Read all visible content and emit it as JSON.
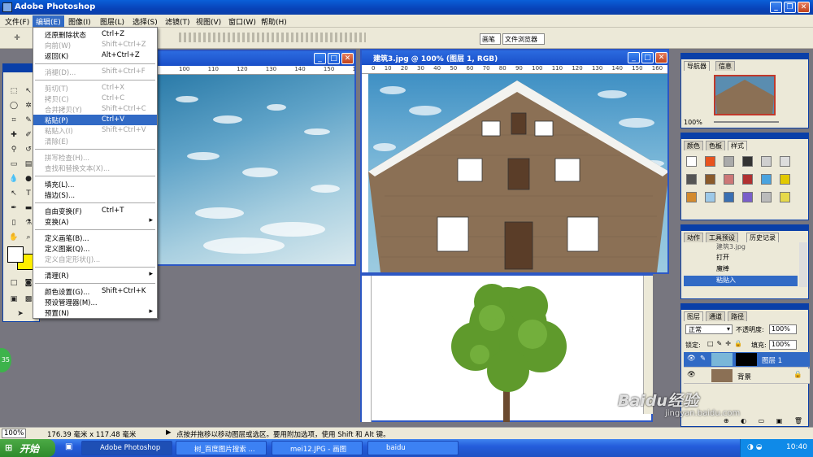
{
  "app": {
    "title": "Adobe Photoshop"
  },
  "menubar": [
    "文件(F)",
    "编辑(E)",
    "图像(I)",
    "图层(L)",
    "选择(S)",
    "滤镜(T)",
    "视图(V)",
    "窗口(W)",
    "帮助(H)"
  ],
  "optbar": {
    "tabs": [
      "画笔",
      "文件浏览器"
    ]
  },
  "edit_menu": [
    {
      "label": "还原删除状态",
      "shortcut": "Ctrl+Z",
      "state": "enabled"
    },
    {
      "label": "向前(W)",
      "shortcut": "Shift+Ctrl+Z",
      "state": "disabled"
    },
    {
      "label": "返回(K)",
      "shortcut": "Alt+Ctrl+Z",
      "state": "enabled"
    },
    {
      "sep": true
    },
    {
      "label": "消褪(D)...",
      "shortcut": "Shift+Ctrl+F",
      "state": "disabled"
    },
    {
      "sep": true
    },
    {
      "label": "剪切(T)",
      "shortcut": "Ctrl+X",
      "state": "disabled"
    },
    {
      "label": "拷贝(C)",
      "shortcut": "Ctrl+C",
      "state": "disabled"
    },
    {
      "label": "合并拷贝(Y)",
      "shortcut": "Shift+Ctrl+C",
      "state": "disabled"
    },
    {
      "label": "粘贴(P)",
      "shortcut": "Ctrl+V",
      "state": "highlighted"
    },
    {
      "label": "粘贴入(I)",
      "shortcut": "Shift+Ctrl+V",
      "state": "disabled"
    },
    {
      "label": "清除(E)",
      "shortcut": "",
      "state": "disabled"
    },
    {
      "sep": true
    },
    {
      "label": "拼写检查(H)...",
      "shortcut": "",
      "state": "disabled"
    },
    {
      "label": "查找和替换文本(X)...",
      "shortcut": "",
      "state": "disabled"
    },
    {
      "sep": true
    },
    {
      "label": "填充(L)...",
      "shortcut": "",
      "state": "enabled"
    },
    {
      "label": "描边(S)...",
      "shortcut": "",
      "state": "enabled"
    },
    {
      "sep": true
    },
    {
      "label": "自由变换(F)",
      "shortcut": "Ctrl+T",
      "state": "enabled"
    },
    {
      "label": "变换(A)",
      "shortcut": "",
      "state": "enabled",
      "submenu": true
    },
    {
      "sep": true
    },
    {
      "label": "定义画笔(B)...",
      "shortcut": "",
      "state": "enabled"
    },
    {
      "label": "定义图案(Q)...",
      "shortcut": "",
      "state": "enabled"
    },
    {
      "label": "定义自定形状(J)...",
      "shortcut": "",
      "state": "disabled"
    },
    {
      "sep": true
    },
    {
      "label": "清理(R)",
      "shortcut": "",
      "state": "enabled",
      "submenu": true
    },
    {
      "sep": true
    },
    {
      "label": "颜色设置(G)...",
      "shortcut": "Shift+Ctrl+K",
      "state": "enabled"
    },
    {
      "label": "预设管理器(M)...",
      "shortcut": "",
      "state": "enabled"
    },
    {
      "label": "预置(N)",
      "shortcut": "",
      "state": "enabled",
      "submenu": true
    }
  ],
  "doc_building": {
    "title": "建筑3.jpg @ 100% (图层 1, RGB)"
  },
  "ruler_ticks": [
    "0",
    "10",
    "20",
    "30",
    "40",
    "50",
    "60",
    "70",
    "80",
    "90",
    "100",
    "110",
    "120",
    "130",
    "140",
    "150",
    "160"
  ],
  "navigator": {
    "tabs": [
      "导航器",
      "信息"
    ],
    "zoom": "100%"
  },
  "swatches": {
    "tabs": [
      "颜色",
      "色板",
      "样式"
    ]
  },
  "history": {
    "tabs": [
      "动作",
      "工具预设",
      "历史记录"
    ],
    "items": [
      "建筑3.jpg",
      "打开",
      "魔棒",
      "粘贴入"
    ]
  },
  "layers": {
    "tabs": [
      "图层",
      "通道",
      "路径"
    ],
    "blend_mode": "正常",
    "opacity_label": "不透明度:",
    "opacity": "100%",
    "lock_label": "锁定:",
    "fill_label": "填充:",
    "fill": "100%",
    "items": [
      {
        "name": "图层 1"
      },
      {
        "name": "背景"
      }
    ]
  },
  "status": {
    "zoom": "100%",
    "size": "176.39 毫米 x 117.48 毫米",
    "hint": "点按并拖移以移动图层或选区。要用附加选项，使用 Shift 和 Alt 键。"
  },
  "taskbar": {
    "start": "开始",
    "tasks": [
      "Adobe Photoshop",
      "树_百度图片搜索 ...",
      "mei12.JPG - 画图",
      "baidu"
    ],
    "time": "10:40"
  },
  "watermark": {
    "brand": "Baidu经验",
    "url": "jingyan.baidu.com"
  },
  "badge": "35"
}
